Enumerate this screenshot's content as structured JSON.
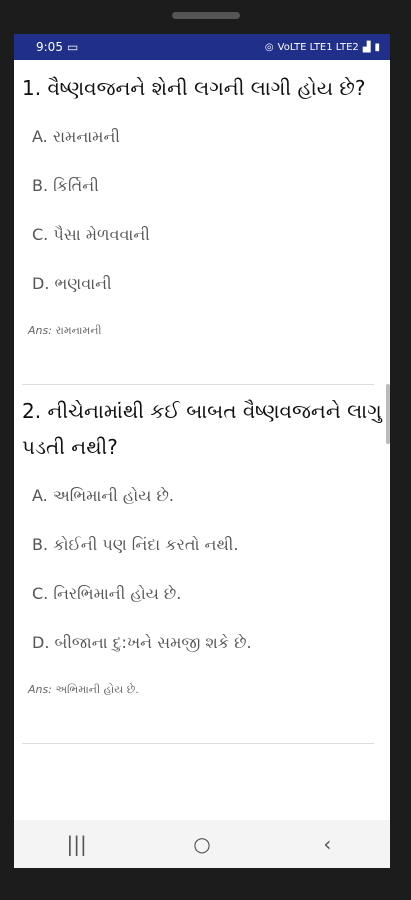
{
  "status_bar": {
    "time": "9:05",
    "signal_text": "VoLTE LTE1 LTE2"
  },
  "questions": [
    {
      "text": "1. વૈષ્ણવજનને શેની લગની લાગી હોય છે?",
      "options": [
        "A. રામનામની",
        "B. કિર્તિની",
        "C. પૈસા મેળવવાની",
        "D. ભણવાની"
      ],
      "answer_label": "Ans:",
      "answer": "રામનામની"
    },
    {
      "text": "2. નીચેનામાંથી કઈ બાબત વૈષ્ણવજનને લાગુ પડતી નથી?",
      "options": [
        "A. અભિમાની હોય છે.",
        "B. કોઈની પણ નિંદા કરતો નથી.",
        "C. નિરભિમાની હોય છે.",
        "D. બીજાના દુ:ખને સમજી શકે છે."
      ],
      "answer_label": "Ans:",
      "answer": "અભિમાની હોય છે."
    }
  ],
  "nav": {
    "recents": "|||",
    "home": "○",
    "back": "‹"
  }
}
